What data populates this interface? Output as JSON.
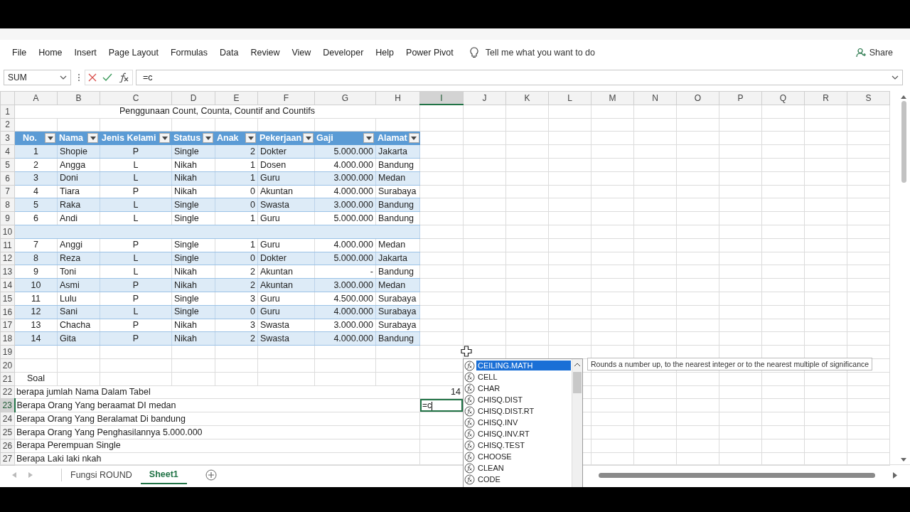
{
  "ribbon": {
    "tabs": [
      "File",
      "Home",
      "Insert",
      "Page Layout",
      "Formulas",
      "Data",
      "Review",
      "View",
      "Developer",
      "Help",
      "Power Pivot"
    ],
    "tell_me": "Tell me what you want to do",
    "share": "Share"
  },
  "formula_bar": {
    "name_box": "SUM",
    "formula": "=c"
  },
  "sheet": {
    "columns": [
      {
        "label": "A",
        "selected": false
      },
      {
        "label": "B",
        "selected": false
      },
      {
        "label": "C",
        "selected": false
      },
      {
        "label": "D",
        "selected": false
      },
      {
        "label": "E",
        "selected": false
      },
      {
        "label": "F",
        "selected": false
      },
      {
        "label": "G",
        "selected": false
      },
      {
        "label": "H",
        "selected": false
      },
      {
        "label": "I",
        "selected": true
      },
      {
        "label": "J",
        "selected": false
      },
      {
        "label": "K",
        "selected": false
      },
      {
        "label": "L",
        "selected": false
      },
      {
        "label": "M",
        "selected": false
      },
      {
        "label": "N",
        "selected": false
      },
      {
        "label": "O",
        "selected": false
      },
      {
        "label": "P",
        "selected": false
      },
      {
        "label": "Q",
        "selected": false
      },
      {
        "label": "R",
        "selected": false
      },
      {
        "label": "S",
        "selected": false
      }
    ],
    "rows": [
      {
        "number": "1",
        "selected": false,
        "kind": "title",
        "text": "Penggunaan Count, Counta, Countif and Countifs"
      },
      {
        "number": "2",
        "selected": false,
        "kind": "empty"
      },
      {
        "number": "3",
        "selected": false,
        "kind": "header",
        "cells": [
          "No.",
          "Nama",
          "Jenis Kelami",
          "Status",
          "Anak",
          "Pekerjaan",
          "Gaji",
          "Alamat"
        ]
      },
      {
        "number": "4",
        "selected": false,
        "kind": "data",
        "cells": [
          "1",
          "Shopie",
          "P",
          "Single",
          "2",
          "Dokter",
          "5.000.000",
          "Jakarta"
        ]
      },
      {
        "number": "5",
        "selected": false,
        "kind": "data",
        "cells": [
          "2",
          "Angga",
          "L",
          "Nikah",
          "1",
          "Dosen",
          "4.000.000",
          "Bandung"
        ]
      },
      {
        "number": "6",
        "selected": false,
        "kind": "data",
        "cells": [
          "3",
          "Doni",
          "L",
          "Nikah",
          "1",
          "Guru",
          "3.000.000",
          "Medan"
        ]
      },
      {
        "number": "7",
        "selected": false,
        "kind": "data",
        "cells": [
          "4",
          "Tiara",
          "P",
          "Nikah",
          "0",
          "Akuntan",
          "4.000.000",
          "Surabaya"
        ]
      },
      {
        "number": "8",
        "selected": false,
        "kind": "data",
        "cells": [
          "5",
          "Raka",
          "L",
          "Single",
          "0",
          "Swasta",
          "3.000.000",
          "Bandung"
        ]
      },
      {
        "number": "9",
        "selected": false,
        "kind": "data",
        "cells": [
          "6",
          "Andi",
          "L",
          "Single",
          "1",
          "Guru",
          "5.000.000",
          "Bandung"
        ]
      },
      {
        "number": "10",
        "selected": false,
        "kind": "band"
      },
      {
        "number": "11",
        "selected": false,
        "kind": "data",
        "cells": [
          "7",
          "Anggi",
          "P",
          "Single",
          "1",
          "Guru",
          "4.000.000",
          "Medan"
        ]
      },
      {
        "number": "12",
        "selected": false,
        "kind": "data",
        "cells": [
          "8",
          "Reza",
          "L",
          "Single",
          "0",
          "Dokter",
          "5.000.000",
          "Jakarta"
        ]
      },
      {
        "number": "13",
        "selected": false,
        "kind": "data",
        "cells": [
          "9",
          "Toni",
          "L",
          "Nikah",
          "2",
          "Akuntan",
          "-",
          "Bandung"
        ]
      },
      {
        "number": "14",
        "selected": false,
        "kind": "data",
        "cells": [
          "10",
          "Asmi",
          "P",
          "Nikah",
          "2",
          "Akuntan",
          "3.000.000",
          "Medan"
        ]
      },
      {
        "number": "15",
        "selected": false,
        "kind": "data",
        "cells": [
          "11",
          "Lulu",
          "P",
          "Single",
          "3",
          "Guru",
          "4.500.000",
          "Surabaya"
        ]
      },
      {
        "number": "16",
        "selected": false,
        "kind": "data",
        "cells": [
          "12",
          "Sani",
          "L",
          "Single",
          "0",
          "Guru",
          "4.000.000",
          "Surabaya"
        ]
      },
      {
        "number": "17",
        "selected": false,
        "kind": "data",
        "cells": [
          "13",
          "Chacha",
          "P",
          "Nikah",
          "3",
          "Swasta",
          "3.000.000",
          "Surabaya"
        ]
      },
      {
        "number": "18",
        "selected": false,
        "kind": "data",
        "cells": [
          "14",
          "Gita",
          "P",
          "Nikah",
          "2",
          "Swasta",
          "4.000.000",
          "Bandung"
        ]
      },
      {
        "number": "19",
        "selected": false,
        "kind": "empty"
      },
      {
        "number": "20",
        "selected": false,
        "kind": "empty"
      },
      {
        "number": "21",
        "selected": false,
        "kind": "label",
        "text": "Soal"
      },
      {
        "number": "22",
        "selected": false,
        "kind": "question",
        "text": "berapa jumlah Nama Dalam Tabel",
        "answer": "14"
      },
      {
        "number": "23",
        "selected": true,
        "kind": "question",
        "text": "Berapa Orang Yang beraamat DI medan",
        "editing": "=c"
      },
      {
        "number": "24",
        "selected": false,
        "kind": "question",
        "text": "Berapa Orang Yang Beralamat Di bandung"
      },
      {
        "number": "25",
        "selected": false,
        "kind": "question",
        "text": "Berapa Orang Yang Penghasilannya 5.000.000"
      },
      {
        "number": "26",
        "selected": false,
        "kind": "question",
        "text": "Berapa Perempuan Single"
      },
      {
        "number": "27",
        "selected": false,
        "kind": "question",
        "text": "Berapa Laki laki nkah"
      }
    ]
  },
  "autocomplete": {
    "items": [
      {
        "label": "CEILING.MATH",
        "selected": true
      },
      {
        "label": "CELL",
        "selected": false
      },
      {
        "label": "CHAR",
        "selected": false
      },
      {
        "label": "CHISQ.DIST",
        "selected": false
      },
      {
        "label": "CHISQ.DIST.RT",
        "selected": false
      },
      {
        "label": "CHISQ.INV",
        "selected": false
      },
      {
        "label": "CHISQ.INV.RT",
        "selected": false
      },
      {
        "label": "CHISQ.TEST",
        "selected": false
      },
      {
        "label": "CHOOSE",
        "selected": false
      },
      {
        "label": "CLEAN",
        "selected": false
      },
      {
        "label": "CODE",
        "selected": false
      }
    ],
    "tooltip": "Rounds a number up, to the nearest integer or to the nearest multiple of significance"
  },
  "sheet_tabs": [
    {
      "label": "Fungsi ROUND",
      "selected": false
    },
    {
      "label": "Sheet1",
      "selected": true
    }
  ]
}
